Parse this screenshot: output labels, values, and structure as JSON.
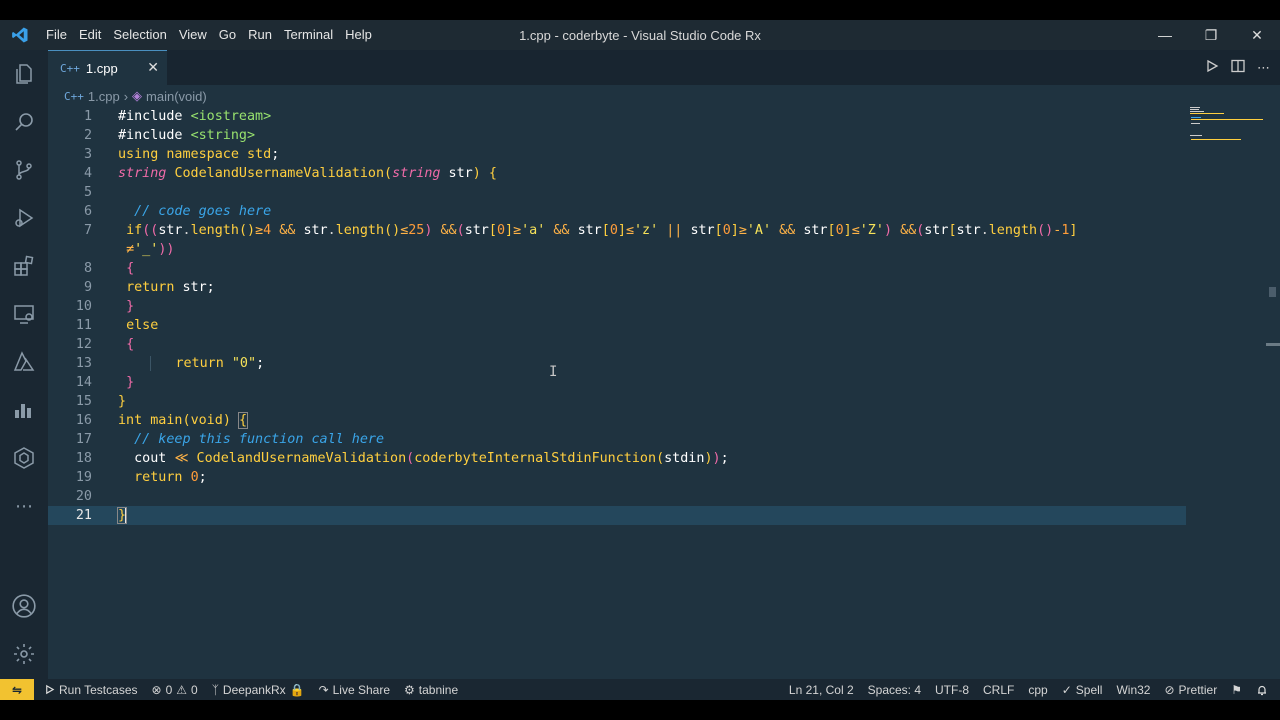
{
  "window": {
    "title": "1.cpp - coderbyte - Visual Studio Code Rx",
    "menu": [
      "File",
      "Edit",
      "Selection",
      "View",
      "Go",
      "Run",
      "Terminal",
      "Help"
    ]
  },
  "activitybar": {
    "icons": [
      "explorer-icon",
      "search-icon",
      "source-control-icon",
      "run-debug-icon",
      "extensions-icon",
      "remote-explorer-icon",
      "azure-icon",
      "charts-icon",
      "docker-icon",
      "more-icon",
      "account-icon",
      "settings-gear-icon"
    ]
  },
  "tab": {
    "file_icon": "C++",
    "label": "1.cpp"
  },
  "breadcrumb": {
    "file_icon": "C++",
    "file": "1.cpp",
    "symbol": "main(void)"
  },
  "editor": {
    "lines": [
      {
        "n": "1"
      },
      {
        "n": "2"
      },
      {
        "n": "3"
      },
      {
        "n": "4"
      },
      {
        "n": "5"
      },
      {
        "n": "6"
      },
      {
        "n": "7"
      },
      {
        "n": "8"
      },
      {
        "n": "9"
      },
      {
        "n": "10"
      },
      {
        "n": "11"
      },
      {
        "n": "12"
      },
      {
        "n": "13"
      },
      {
        "n": "14"
      },
      {
        "n": "15"
      },
      {
        "n": "16"
      },
      {
        "n": "17"
      },
      {
        "n": "18"
      },
      {
        "n": "19"
      },
      {
        "n": "20"
      },
      {
        "n": "21"
      }
    ],
    "current_line": 21
  },
  "statusbar": {
    "remote_icon": "remote-icon",
    "run_testcases": "Run Testcases",
    "errors": "0",
    "warnings": "0",
    "branch": "DeepankRx",
    "live_share": "Live Share",
    "tabnine": "tabnine",
    "position": "Ln 21, Col 2",
    "spaces": "Spaces: 4",
    "encoding": "UTF-8",
    "eol": "CRLF",
    "language": "cpp",
    "spell": "Spell",
    "platform": "Win32",
    "prettier": "Prettier"
  }
}
